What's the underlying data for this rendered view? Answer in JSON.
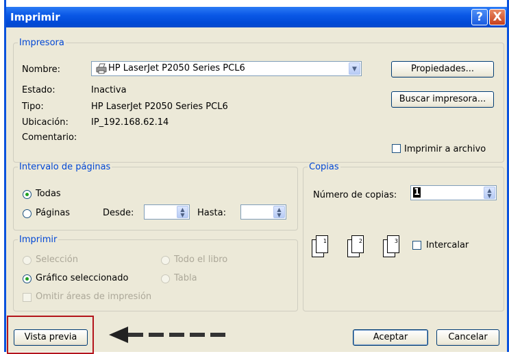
{
  "window": {
    "title": "Imprimir",
    "help_glyph": "?",
    "close_glyph": "X"
  },
  "printer": {
    "legend": "Impresora",
    "name_label": "Nombre:",
    "name_value": "HP LaserJet P2050 Series PCL6",
    "state_label": "Estado:",
    "state_value": "Inactiva",
    "type_label": "Tipo:",
    "type_value": "HP LaserJet P2050 Series PCL6",
    "location_label": "Ubicación:",
    "location_value": "IP_192.168.62.14",
    "comment_label": "Comentario:",
    "properties_button": "Propiedades...",
    "find_button": "Buscar impresora...",
    "print_to_file": "Imprimir a archivo"
  },
  "range": {
    "legend": "Intervalo de páginas",
    "all": "Todas",
    "pages": "Páginas",
    "from_label": "Desde:",
    "to_label": "Hasta:"
  },
  "print_what": {
    "legend": "Imprimir",
    "selection": "Selección",
    "workbook": "Todo el libro",
    "chart": "Gráfico seleccionado",
    "table": "Tabla",
    "ignore_areas": "Omitir áreas de impresión"
  },
  "copies": {
    "legend": "Copias",
    "count_label": "Número de copias:",
    "count_value": "1",
    "collate": "Intercalar"
  },
  "footer": {
    "preview_button": "Vista previa",
    "ok_button": "Aceptar",
    "cancel_button": "Cancelar"
  },
  "colors": {
    "accent": "#0046d5",
    "highlight": "#b3141b"
  }
}
